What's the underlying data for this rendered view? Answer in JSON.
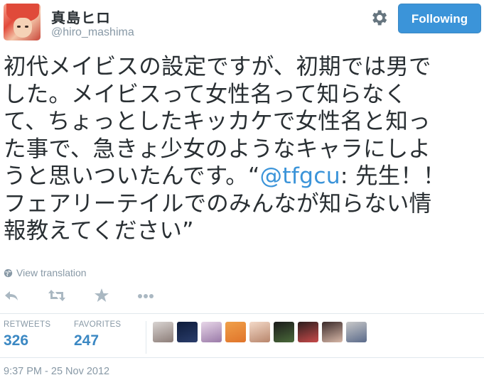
{
  "user": {
    "display_name": "真島ヒロ",
    "handle": "@hiro_mashima"
  },
  "header": {
    "follow_label": "Following"
  },
  "tweet": {
    "lines": [
      "初代メイビスの設定ですが、初期では男で",
      "した。メイビスって女性名って知らなく",
      "て、ちょっとしたキッカケで女性名と知っ",
      "た事で、急きょ少女のようなキャラにしよ",
      "うと思いついたんです。“",
      "@tfgcu",
      ": 先生！！",
      "フェアリーテイルでのみんなが知らない情",
      "報教えてください”"
    ],
    "translate_label": "View translation"
  },
  "stats": {
    "retweets_label": "RETWEETS",
    "retweets_count": "326",
    "favorites_label": "FAVORITES",
    "favorites_count": "247"
  },
  "favoriters": [
    {
      "name": "faverer-avatar-1",
      "colors": [
        "#d9d4d2",
        "#8c7d78"
      ]
    },
    {
      "name": "faverer-avatar-2",
      "colors": [
        "#0d1b3a",
        "#2a3d6b"
      ]
    },
    {
      "name": "faverer-avatar-3",
      "colors": [
        "#e7d6e8",
        "#9a7aa8"
      ]
    },
    {
      "name": "faverer-avatar-4",
      "colors": [
        "#f0a04a",
        "#e0742a"
      ]
    },
    {
      "name": "faverer-avatar-5",
      "colors": [
        "#f3d9c8",
        "#b8866c"
      ]
    },
    {
      "name": "faverer-avatar-6",
      "colors": [
        "#1a1a1a",
        "#4a6a3a"
      ]
    },
    {
      "name": "faverer-avatar-7",
      "colors": [
        "#2c1e1e",
        "#c84a4a"
      ]
    },
    {
      "name": "faverer-avatar-8",
      "colors": [
        "#3a2a2a",
        "#d8b8a8"
      ]
    },
    {
      "name": "faverer-avatar-9",
      "colors": [
        "#c8c8c8",
        "#5a6a8a"
      ]
    }
  ],
  "timestamp": "9:37 PM - 25 Nov 2012",
  "colors": {
    "link": "#3b94d9",
    "muted": "#8899a6",
    "follow_button": "#3b94d9",
    "stat_value": "#3b88c3"
  },
  "icons": [
    "gear-icon",
    "globe-icon",
    "reply-icon",
    "retweet-icon",
    "favorite-icon",
    "more-icon"
  ]
}
